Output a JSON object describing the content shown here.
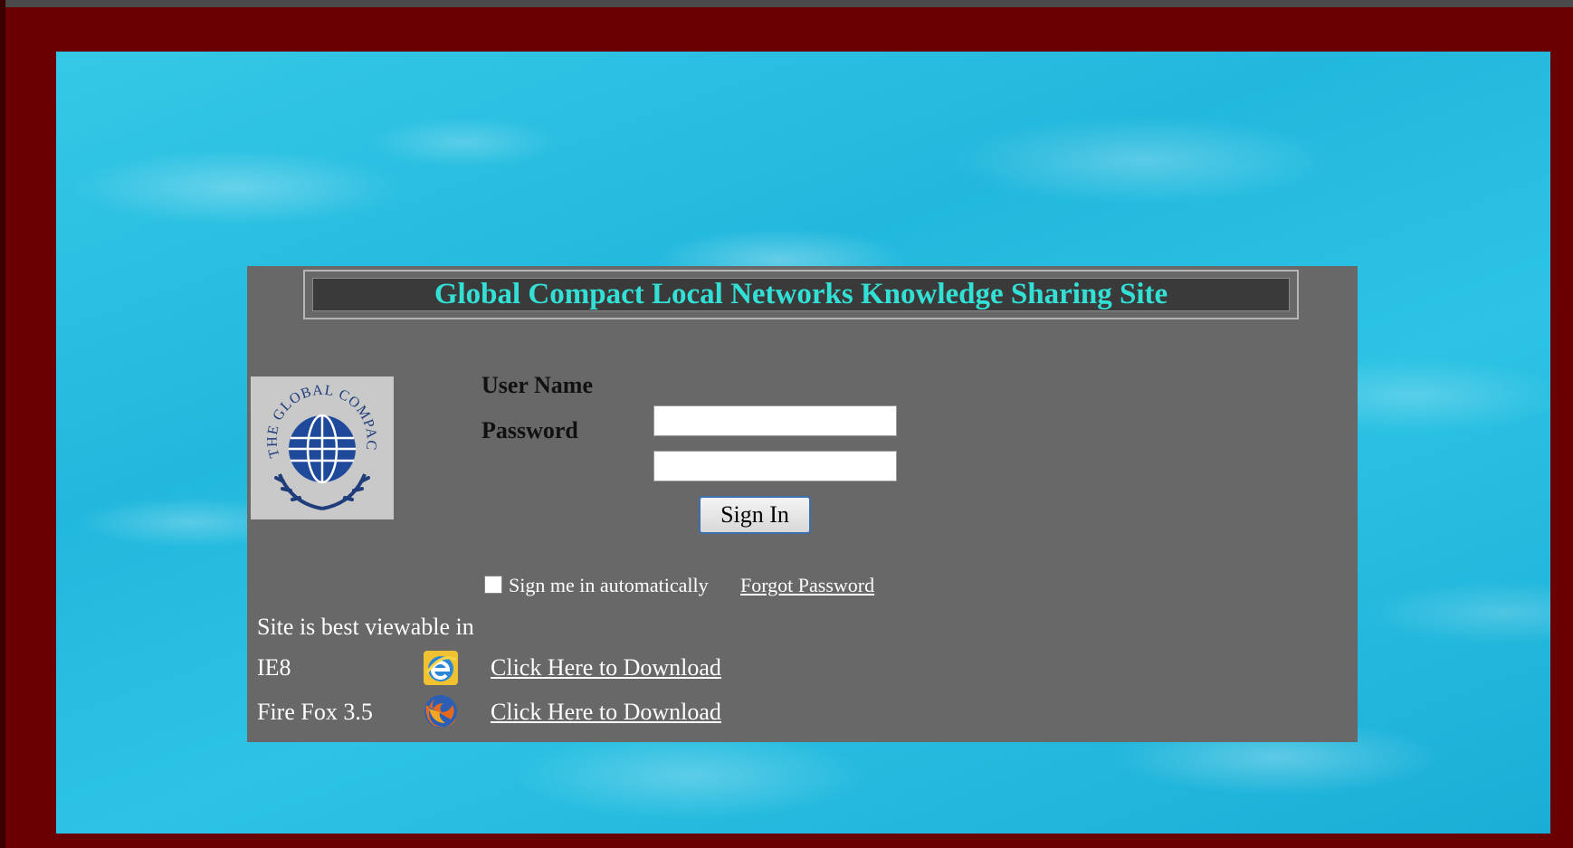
{
  "site": {
    "title": "Global Compact Local Networks Knowledge Sharing Site",
    "logo_text": "THE GLOBAL COMPACT"
  },
  "login": {
    "username_label": "User Name",
    "username_value": "",
    "password_label": "Password",
    "password_value": "",
    "signin_label": "Sign In",
    "remember_label": "Sign me in automatically",
    "remember_checked": false,
    "forgot_label": "Forgot Password"
  },
  "browsers": {
    "heading": "Site is best viewable in",
    "items": [
      {
        "name": "IE8",
        "icon": "ie-icon",
        "link_label": "Click Here to Download"
      },
      {
        "name": "Fire Fox 3.5",
        "icon": "firefox-icon",
        "link_label": "Click Here to Download"
      }
    ]
  },
  "colors": {
    "frame": "#6b0000",
    "panel": "#686868",
    "title_text": "#33e0d6",
    "water": "#22b8dd"
  }
}
